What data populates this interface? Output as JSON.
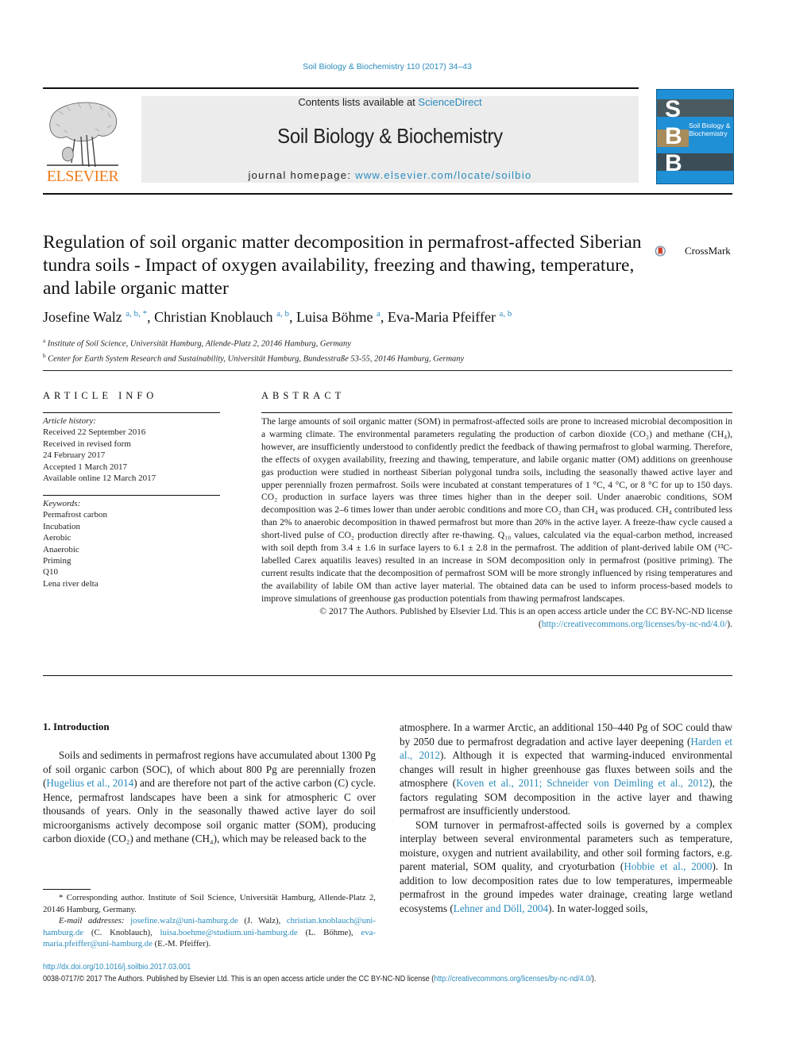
{
  "journal_ref": "Soil Biology & Biochemistry 110 (2017) 34–43",
  "header": {
    "publisher_logo_text": "ELSEVIER",
    "contents_prefix": "Contents lists available at ",
    "contents_link": "ScienceDirect",
    "journal_title": "Soil Biology & Biochemistry",
    "homepage_prefix": "journal homepage: ",
    "homepage_link": "www.elsevier.com/locate/soilbio",
    "cover": {
      "letters": [
        "S",
        "B",
        "B"
      ],
      "title_line1": "Soil Biology &",
      "title_line2": "Biochemistry"
    }
  },
  "article": {
    "title": "Regulation of soil organic matter decomposition in permafrost-affected Siberian tundra soils - Impact of oxygen availability, freezing and thawing, temperature, and labile organic matter",
    "crossmark_label": "CrossMark",
    "authors": [
      {
        "name": "Josefine Walz",
        "affil": "a, b, *"
      },
      {
        "name": "Christian Knoblauch",
        "affil": "a, b"
      },
      {
        "name": "Luisa Böhme",
        "affil": "a"
      },
      {
        "name": "Eva-Maria Pfeiffer",
        "affil": "a, b"
      }
    ],
    "affiliations": [
      {
        "key": "a",
        "text": "Institute of Soil Science, Universität Hamburg, Allende-Platz 2, 20146 Hamburg, Germany"
      },
      {
        "key": "b",
        "text": "Center for Earth System Research and Sustainability, Universität Hamburg, Bundesstraße 53-55, 20146 Hamburg, Germany"
      }
    ]
  },
  "article_info": {
    "heading": "ARTICLE INFO",
    "history_label": "Article history:",
    "history": [
      "Received 22 September 2016",
      "Received in revised form",
      "24 February 2017",
      "Accepted 1 March 2017",
      "Available online 12 March 2017"
    ],
    "keywords_label": "Keywords:",
    "keywords": [
      "Permafrost carbon",
      "Incubation",
      "Aerobic",
      "Anaerobic",
      "Priming",
      "Q10",
      "Lena river delta"
    ]
  },
  "abstract": {
    "heading": "ABSTRACT",
    "text": "The large amounts of soil organic matter (SOM) in permafrost-affected soils are prone to increased microbial decomposition in a warming climate. The environmental parameters regulating the production of carbon dioxide (CO₂) and methane (CH₄), however, are insufficiently understood to confidently predict the feedback of thawing permafrost to global warming. Therefore, the effects of oxygen availability, freezing and thawing, temperature, and labile organic matter (OM) additions on greenhouse gas production were studied in northeast Siberian polygonal tundra soils, including the seasonally thawed active layer and upper perennially frozen permafrost. Soils were incubated at constant temperatures of 1 °C, 4 °C, or 8 °C for up to 150 days. CO₂ production in surface layers was three times higher than in the deeper soil. Under anaerobic conditions, SOM decomposition was 2–6 times lower than under aerobic conditions and more CO₂ than CH₄ was produced. CH₄ contributed less than 2% to anaerobic decomposition in thawed permafrost but more than 20% in the active layer. A freeze-thaw cycle caused a short-lived pulse of CO₂ production directly after re-thawing. Q₁₀ values, calculated via the equal-carbon method, increased with soil depth from 3.4 ± 1.6 in surface layers to 6.1 ± 2.8 in the permafrost. The addition of plant-derived labile OM (¹³C-labelled Carex aquatilis leaves) resulted in an increase in SOM decomposition only in permafrost (positive priming). The current results indicate that the decomposition of permafrost SOM will be more strongly influenced by rising temperatures and the availability of labile OM than active layer material. The obtained data can be used to inform process-based models to improve simulations of greenhouse gas production potentials from thawing permafrost landscapes.",
    "copyright_prefix": "© 2017 The Authors. Published by Elsevier Ltd. This is an open access article under the CC BY-NC-ND license (",
    "copyright_link": "http://creativecommons.org/licenses/by-nc-nd/4.0/",
    "copyright_suffix": ")."
  },
  "introduction": {
    "heading": "1.  Introduction",
    "p1_a": "Soils and sediments in permafrost regions have accumulated about 1300 Pg of soil organic carbon (SOC), of which about 800 Pg are perennially frozen (",
    "p1_cite1": "Hugelius et al., 2014",
    "p1_b": ") and are therefore not part of the active carbon (C) cycle. Hence, permafrost landscapes have been a sink for atmospheric C over thousands of years. Only in the seasonally thawed active layer do soil microorganisms actively decompose soil organic matter (SOM), producing carbon dioxide (CO₂) and methane (CH₄), which may be released back to the",
    "p1_c": "atmosphere. In a warmer Arctic, an additional 150–440 Pg of SOC could thaw by 2050 due to permafrost degradation and active layer deepening (",
    "p1_cite2": "Harden et al., 2012",
    "p1_d": "). Although it is expected that warming-induced environmental changes will result in higher greenhouse gas fluxes between soils and the atmosphere (",
    "p1_cite3": "Koven et al., 2011; Schneider von Deimling et al., 2012",
    "p1_e": "), the factors regulating SOM decomposition in the active layer and thawing permafrost are insufficiently understood.",
    "p2_a": "SOM turnover in permafrost-affected soils is governed by a complex interplay between several environmental parameters such as temperature, moisture, oxygen and nutrient availability, and other soil forming factors, e.g. parent material, SOM quality, and cryoturbation (",
    "p2_cite1": "Hobbie et al., 2000",
    "p2_b": "). In addition to low decomposition rates due to low temperatures, impermeable permafrost in the ground impedes water drainage, creating large wetland ecosystems (",
    "p2_cite2": "Lehner and Döll, 2004",
    "p2_c": "). In water-logged soils,"
  },
  "footnote": {
    "corresponding": "* Corresponding author. Institute of Soil Science, Universität Hamburg, Allende-Platz 2, 20146 Hamburg, Germany.",
    "email_label": "E-mail addresses:",
    "emails": [
      {
        "address": "josefine.walz@uni-hamburg.de",
        "who": " (J. Walz), "
      },
      {
        "address": "christian.knoblauch@uni-hamburg.de",
        "who": " (C. Knoblauch), "
      },
      {
        "address": "luisa.boehme@studium.uni-hamburg.de",
        "who": " (L. Böhme), "
      },
      {
        "address": "eva-maria.pfeiffer@uni-hamburg.de",
        "who": " (E.-M. Pfeiffer)."
      }
    ]
  },
  "page_footer": {
    "doi": "http://dx.doi.org/10.1016/j.soilbio.2017.03.001",
    "issn_prefix": "0038-0717/© 2017 The Authors. Published by Elsevier Ltd. This is an open access article under the CC BY-NC-ND license (",
    "issn_link": "http://creativecommons.org/licenses/by-nc-nd/4.0/",
    "issn_suffix": ")."
  }
}
